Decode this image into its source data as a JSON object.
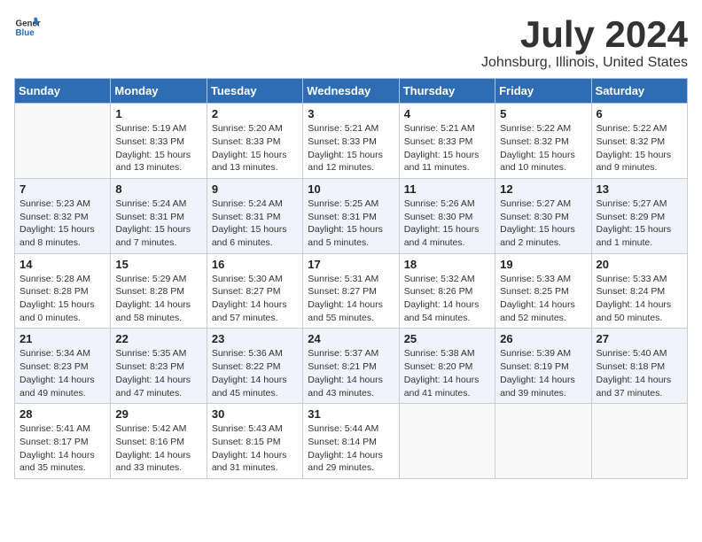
{
  "logo": {
    "general": "General",
    "blue": "Blue"
  },
  "title": {
    "month": "July 2024",
    "location": "Johnsburg, Illinois, United States"
  },
  "weekdays": [
    "Sunday",
    "Monday",
    "Tuesday",
    "Wednesday",
    "Thursday",
    "Friday",
    "Saturday"
  ],
  "weeks": [
    [
      {
        "day": "",
        "info": ""
      },
      {
        "day": "1",
        "info": "Sunrise: 5:19 AM\nSunset: 8:33 PM\nDaylight: 15 hours\nand 13 minutes."
      },
      {
        "day": "2",
        "info": "Sunrise: 5:20 AM\nSunset: 8:33 PM\nDaylight: 15 hours\nand 13 minutes."
      },
      {
        "day": "3",
        "info": "Sunrise: 5:21 AM\nSunset: 8:33 PM\nDaylight: 15 hours\nand 12 minutes."
      },
      {
        "day": "4",
        "info": "Sunrise: 5:21 AM\nSunset: 8:33 PM\nDaylight: 15 hours\nand 11 minutes."
      },
      {
        "day": "5",
        "info": "Sunrise: 5:22 AM\nSunset: 8:32 PM\nDaylight: 15 hours\nand 10 minutes."
      },
      {
        "day": "6",
        "info": "Sunrise: 5:22 AM\nSunset: 8:32 PM\nDaylight: 15 hours\nand 9 minutes."
      }
    ],
    [
      {
        "day": "7",
        "info": "Sunrise: 5:23 AM\nSunset: 8:32 PM\nDaylight: 15 hours\nand 8 minutes."
      },
      {
        "day": "8",
        "info": "Sunrise: 5:24 AM\nSunset: 8:31 PM\nDaylight: 15 hours\nand 7 minutes."
      },
      {
        "day": "9",
        "info": "Sunrise: 5:24 AM\nSunset: 8:31 PM\nDaylight: 15 hours\nand 6 minutes."
      },
      {
        "day": "10",
        "info": "Sunrise: 5:25 AM\nSunset: 8:31 PM\nDaylight: 15 hours\nand 5 minutes."
      },
      {
        "day": "11",
        "info": "Sunrise: 5:26 AM\nSunset: 8:30 PM\nDaylight: 15 hours\nand 4 minutes."
      },
      {
        "day": "12",
        "info": "Sunrise: 5:27 AM\nSunset: 8:30 PM\nDaylight: 15 hours\nand 2 minutes."
      },
      {
        "day": "13",
        "info": "Sunrise: 5:27 AM\nSunset: 8:29 PM\nDaylight: 15 hours\nand 1 minute."
      }
    ],
    [
      {
        "day": "14",
        "info": "Sunrise: 5:28 AM\nSunset: 8:28 PM\nDaylight: 15 hours\nand 0 minutes."
      },
      {
        "day": "15",
        "info": "Sunrise: 5:29 AM\nSunset: 8:28 PM\nDaylight: 14 hours\nand 58 minutes."
      },
      {
        "day": "16",
        "info": "Sunrise: 5:30 AM\nSunset: 8:27 PM\nDaylight: 14 hours\nand 57 minutes."
      },
      {
        "day": "17",
        "info": "Sunrise: 5:31 AM\nSunset: 8:27 PM\nDaylight: 14 hours\nand 55 minutes."
      },
      {
        "day": "18",
        "info": "Sunrise: 5:32 AM\nSunset: 8:26 PM\nDaylight: 14 hours\nand 54 minutes."
      },
      {
        "day": "19",
        "info": "Sunrise: 5:33 AM\nSunset: 8:25 PM\nDaylight: 14 hours\nand 52 minutes."
      },
      {
        "day": "20",
        "info": "Sunrise: 5:33 AM\nSunset: 8:24 PM\nDaylight: 14 hours\nand 50 minutes."
      }
    ],
    [
      {
        "day": "21",
        "info": "Sunrise: 5:34 AM\nSunset: 8:23 PM\nDaylight: 14 hours\nand 49 minutes."
      },
      {
        "day": "22",
        "info": "Sunrise: 5:35 AM\nSunset: 8:23 PM\nDaylight: 14 hours\nand 47 minutes."
      },
      {
        "day": "23",
        "info": "Sunrise: 5:36 AM\nSunset: 8:22 PM\nDaylight: 14 hours\nand 45 minutes."
      },
      {
        "day": "24",
        "info": "Sunrise: 5:37 AM\nSunset: 8:21 PM\nDaylight: 14 hours\nand 43 minutes."
      },
      {
        "day": "25",
        "info": "Sunrise: 5:38 AM\nSunset: 8:20 PM\nDaylight: 14 hours\nand 41 minutes."
      },
      {
        "day": "26",
        "info": "Sunrise: 5:39 AM\nSunset: 8:19 PM\nDaylight: 14 hours\nand 39 minutes."
      },
      {
        "day": "27",
        "info": "Sunrise: 5:40 AM\nSunset: 8:18 PM\nDaylight: 14 hours\nand 37 minutes."
      }
    ],
    [
      {
        "day": "28",
        "info": "Sunrise: 5:41 AM\nSunset: 8:17 PM\nDaylight: 14 hours\nand 35 minutes."
      },
      {
        "day": "29",
        "info": "Sunrise: 5:42 AM\nSunset: 8:16 PM\nDaylight: 14 hours\nand 33 minutes."
      },
      {
        "day": "30",
        "info": "Sunrise: 5:43 AM\nSunset: 8:15 PM\nDaylight: 14 hours\nand 31 minutes."
      },
      {
        "day": "31",
        "info": "Sunrise: 5:44 AM\nSunset: 8:14 PM\nDaylight: 14 hours\nand 29 minutes."
      },
      {
        "day": "",
        "info": ""
      },
      {
        "day": "",
        "info": ""
      },
      {
        "day": "",
        "info": ""
      }
    ]
  ]
}
